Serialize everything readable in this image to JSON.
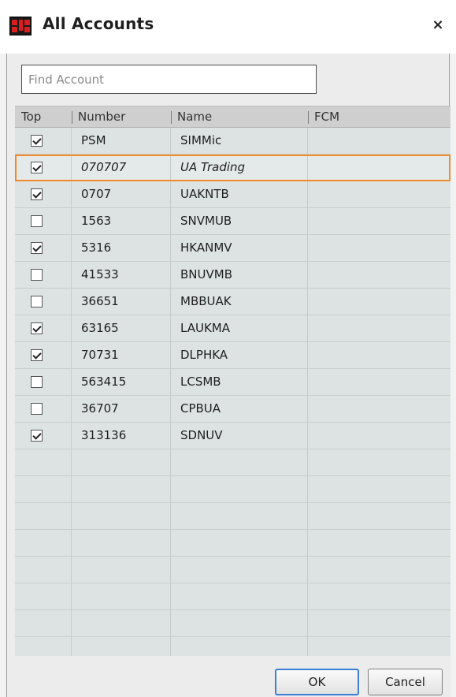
{
  "window": {
    "title": "All Accounts",
    "close_label": "×"
  },
  "search": {
    "placeholder": "Find Account",
    "value": ""
  },
  "table": {
    "columns": [
      "Top",
      "Number",
      "Name",
      "FCM"
    ],
    "rows": [
      {
        "top": true,
        "number": "PSM",
        "name": "SIMMic",
        "fcm": ""
      },
      {
        "top": true,
        "number": "070707",
        "name": "UA Trading",
        "fcm": "",
        "selected": true
      },
      {
        "top": true,
        "number": "0707",
        "name": "UAKNTB",
        "fcm": ""
      },
      {
        "top": false,
        "number": "1563",
        "name": "SNVMUB",
        "fcm": ""
      },
      {
        "top": true,
        "number": "5316",
        "name": "HKANMV",
        "fcm": ""
      },
      {
        "top": false,
        "number": "41533",
        "name": "BNUVMB",
        "fcm": ""
      },
      {
        "top": false,
        "number": "36651",
        "name": "MBBUAK",
        "fcm": ""
      },
      {
        "top": true,
        "number": "63165",
        "name": "LAUKMA",
        "fcm": ""
      },
      {
        "top": true,
        "number": "70731",
        "name": "DLPHKA",
        "fcm": ""
      },
      {
        "top": false,
        "number": "563415",
        "name": "LCSMB",
        "fcm": ""
      },
      {
        "top": false,
        "number": "36707",
        "name": "CPBUA",
        "fcm": ""
      },
      {
        "top": true,
        "number": "313136",
        "name": "SDNUV",
        "fcm": ""
      }
    ],
    "empty_rows": 8
  },
  "buttons": {
    "ok": "OK",
    "cancel": "Cancel"
  },
  "colors": {
    "selection_outline": "#f08a2c",
    "row_bg": "#dde3e3",
    "header_bg": "#cfcfcf",
    "ok_border": "#3d7fd6",
    "icon_red": "#d81e1e"
  }
}
